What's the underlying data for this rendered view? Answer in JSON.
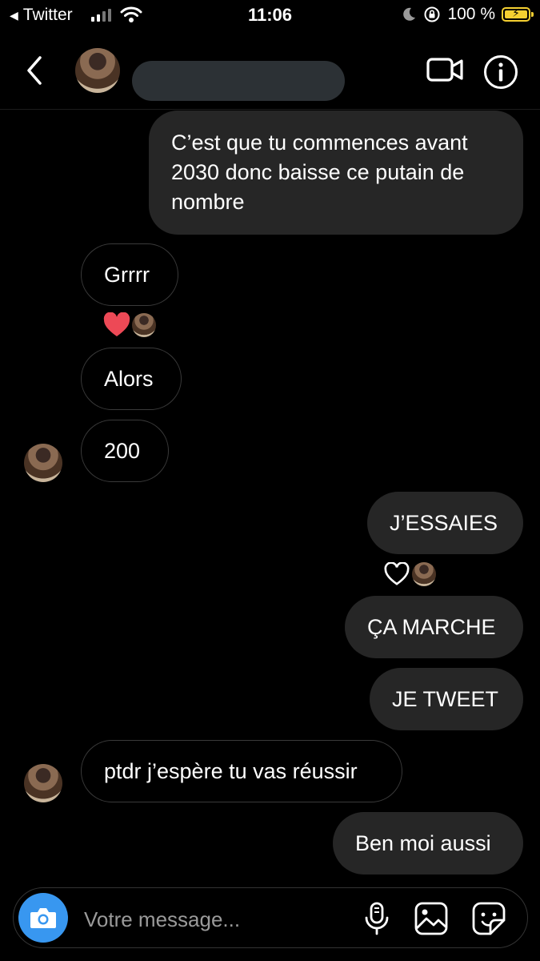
{
  "status_bar": {
    "back_app_label": "Twitter",
    "time": "11:06",
    "battery_percent": "100 %",
    "battery_color": "#f5d031"
  },
  "header": {
    "icons": [
      "chevron-left-icon",
      "video-camera-icon",
      "info-icon"
    ]
  },
  "messages": [
    {
      "direction": "out",
      "text": "C’est que tu commences avant 2030 donc baisse ce putain de nombre"
    },
    {
      "direction": "in",
      "text": "Grrrr",
      "reaction": "red-heart"
    },
    {
      "direction": "in",
      "text": "Alors"
    },
    {
      "direction": "in",
      "text": "200",
      "show_avatar": true
    },
    {
      "direction": "out",
      "text": "J’ESSAIES",
      "reaction": "outline-heart"
    },
    {
      "direction": "out",
      "text": "ÇA MARCHE"
    },
    {
      "direction": "out",
      "text": "JE TWEET"
    },
    {
      "direction": "in",
      "text": "ptdr j’espère tu vas réussir",
      "show_avatar": true
    },
    {
      "direction": "out",
      "text": "Ben moi aussi"
    }
  ],
  "composer": {
    "placeholder": "Votre message...",
    "icons": [
      "camera-icon",
      "microphone-icon",
      "gallery-icon",
      "sticker-icon"
    ],
    "camera_color": "#3897f0"
  },
  "colors": {
    "background": "#000000",
    "outgoing_bubble": "#262626",
    "incoming_border": "#3a3a3a",
    "heart_red": "#ed4956"
  }
}
